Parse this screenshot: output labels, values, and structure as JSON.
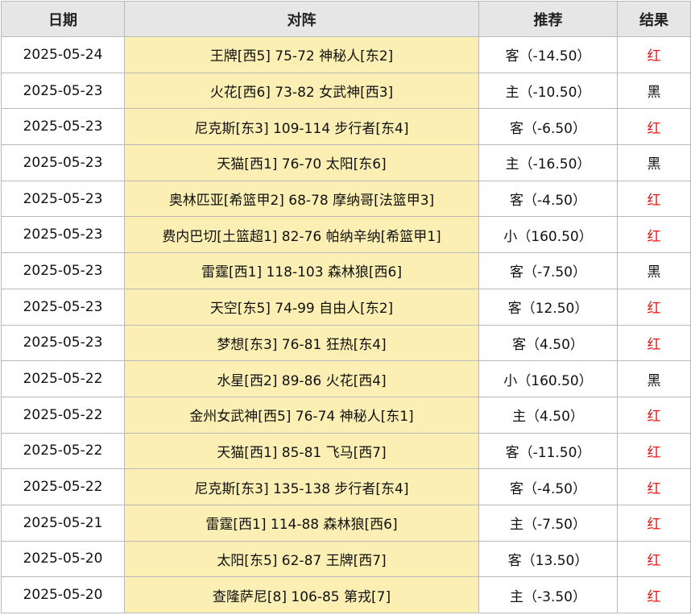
{
  "columns": [
    "日期",
    "对阵",
    "推荐",
    "结果"
  ],
  "colors": {
    "header_bg": "#e6e6e6",
    "match_bg": "#fbefb4",
    "red": "#ee1111",
    "black": "#111111",
    "border": "#b9b9b9"
  },
  "rows": [
    {
      "date": "2025-05-24",
      "match": "王牌[西5] 75-72 神秘人[东2]",
      "pick": "客（-14.50）",
      "result": "红",
      "result_color": "red"
    },
    {
      "date": "2025-05-23",
      "match": "火花[西6] 73-82 女武神[西3]",
      "pick": "主（-10.50）",
      "result": "黑",
      "result_color": "black"
    },
    {
      "date": "2025-05-23",
      "match": "尼克斯[东3] 109-114 步行者[东4]",
      "pick": "客（-6.50）",
      "result": "红",
      "result_color": "red"
    },
    {
      "date": "2025-05-23",
      "match": "天猫[西1] 76-70 太阳[东6]",
      "pick": "主（-16.50）",
      "result": "黑",
      "result_color": "black"
    },
    {
      "date": "2025-05-23",
      "match": "奥林匹亚[希篮甲2] 68-78 摩纳哥[法篮甲3]",
      "pick": "客（-4.50）",
      "result": "红",
      "result_color": "red"
    },
    {
      "date": "2025-05-23",
      "match": "费内巴切[土篮超1] 82-76 帕纳辛纳[希篮甲1]",
      "pick": "小（160.50）",
      "result": "红",
      "result_color": "red"
    },
    {
      "date": "2025-05-23",
      "match": "雷霆[西1] 118-103 森林狼[西6]",
      "pick": "客（-7.50）",
      "result": "黑",
      "result_color": "black"
    },
    {
      "date": "2025-05-23",
      "match": "天空[东5] 74-99 自由人[东2]",
      "pick": "客（12.50）",
      "result": "红",
      "result_color": "red"
    },
    {
      "date": "2025-05-23",
      "match": "梦想[东3] 76-81 狂热[东4]",
      "pick": "客（4.50）",
      "result": "红",
      "result_color": "red"
    },
    {
      "date": "2025-05-22",
      "match": "水星[西2] 89-86 火花[西4]",
      "pick": "小（160.50）",
      "result": "黑",
      "result_color": "black"
    },
    {
      "date": "2025-05-22",
      "match": "金州女武神[西5] 76-74 神秘人[东1]",
      "pick": "主（4.50）",
      "result": "红",
      "result_color": "red"
    },
    {
      "date": "2025-05-22",
      "match": "天猫[西1] 85-81 飞马[西7]",
      "pick": "客（-11.50）",
      "result": "红",
      "result_color": "red"
    },
    {
      "date": "2025-05-22",
      "match": "尼克斯[东3] 135-138 步行者[东4]",
      "pick": "客（-4.50）",
      "result": "红",
      "result_color": "red"
    },
    {
      "date": "2025-05-21",
      "match": "雷霆[西1] 114-88 森林狼[西6]",
      "pick": "主（-7.50）",
      "result": "红",
      "result_color": "red"
    },
    {
      "date": "2025-05-20",
      "match": "太阳[东5] 62-87 王牌[西7]",
      "pick": "客（13.50）",
      "result": "红",
      "result_color": "red"
    },
    {
      "date": "2025-05-20",
      "match": "查隆萨尼[8] 106-85 第戎[7]",
      "pick": "主（-3.50）",
      "result": "红",
      "result_color": "red"
    }
  ]
}
